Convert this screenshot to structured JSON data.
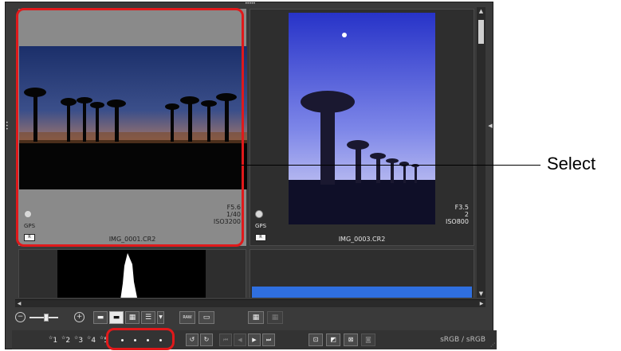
{
  "thumbnails": [
    {
      "filename": "IMG_0001.CR2",
      "aperture": "F5.6",
      "shutter": "1/40",
      "iso": "ISO3200",
      "gps": "GPS",
      "badge": "R",
      "selected": true
    },
    {
      "filename": "IMG_0003.CR2",
      "aperture": "F3.5",
      "shutter": "2",
      "iso": "ISO800",
      "gps": "GPS",
      "badge": "R",
      "selected": false
    }
  ],
  "toolbar_bottom": {
    "ratings": [
      "1",
      "2",
      "3",
      "4",
      "5"
    ],
    "color_space": "sRGB / sRGB"
  },
  "callout": {
    "label": "Select"
  },
  "colors": {
    "highlight": "#e0191b",
    "panel": "#3a3a3a",
    "selected_cell": "#8a8a8a"
  }
}
